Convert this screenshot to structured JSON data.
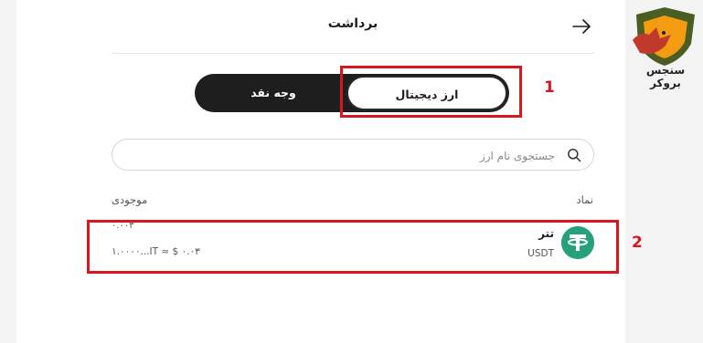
{
  "header": {
    "title": "برداشت",
    "back_icon": "arrow-right-icon"
  },
  "tabs": {
    "digital_label": "ارز دیجیتال",
    "cash_label": "وجه نقد",
    "active": "digital"
  },
  "annotations": {
    "box1_number": "1",
    "box2_number": "2",
    "color": "#d9161e"
  },
  "search": {
    "placeholder": "جستجوی نام ارز",
    "value": "",
    "icon": "search-icon"
  },
  "table": {
    "headers": {
      "symbol": "نماد",
      "balance": "موجودی"
    },
    "rows": [
      {
        "name": "تتر",
        "symbol": "USDT",
        "logo_icon": "tether-logo-icon",
        "logo_color": "#26a17b",
        "balance_top": "۰.۰۰۳",
        "balance_bottom": "۱.۰۰۰۰...IT ≈ $ ۰.۰۳"
      }
    ]
  },
  "brand": {
    "name": "سنجس بروکر",
    "logo_icon": "wolf-shield-logo-icon",
    "colors": {
      "green": "#4a5d23",
      "orange": "#f39c12",
      "red": "#c0392b"
    }
  },
  "colors": {
    "dark": "#1e1e1e",
    "background": "#f3f3f4",
    "accent_red": "#d9161e"
  }
}
